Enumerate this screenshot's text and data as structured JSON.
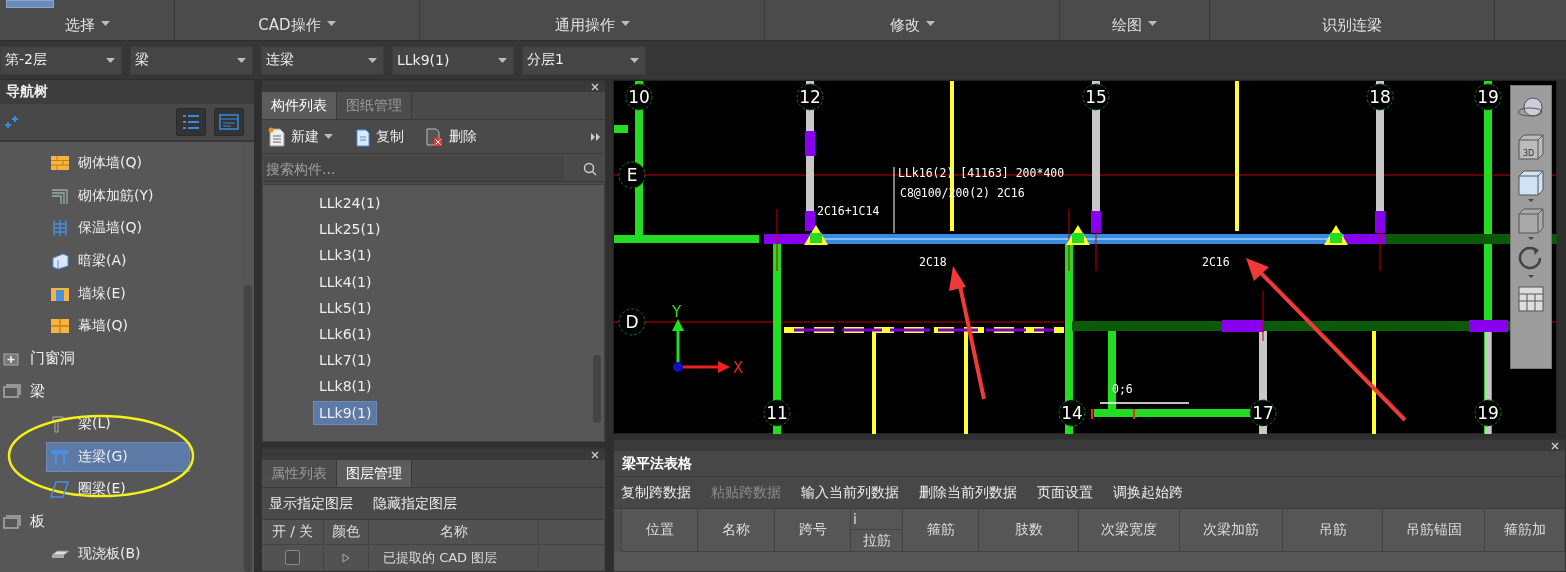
{
  "ribbon": {
    "groups": [
      {
        "label": "选择",
        "caret": true
      },
      {
        "label": "CAD操作",
        "caret": true
      },
      {
        "label": "通用操作",
        "caret": true
      },
      {
        "label": "修改",
        "caret": true
      },
      {
        "label": "绘图",
        "caret": true
      },
      {
        "label": "识别连梁",
        "caret": false
      }
    ]
  },
  "selectors": [
    {
      "value": "第-2层"
    },
    {
      "value": "梁"
    },
    {
      "value": "连梁"
    },
    {
      "value": "LLk9(1)"
    },
    {
      "value": "分层1"
    }
  ],
  "nav_tree": {
    "title": "导航树",
    "items": [
      {
        "kind": "leaf",
        "label": "砌体墙(Q)",
        "selected": false,
        "circled": false
      },
      {
        "kind": "leaf",
        "label": "砌体加筋(Y)",
        "selected": false,
        "circled": false
      },
      {
        "kind": "leaf",
        "label": "保温墙(Q)",
        "selected": false,
        "circled": false
      },
      {
        "kind": "leaf",
        "label": "暗梁(A)",
        "selected": false,
        "circled": false
      },
      {
        "kind": "leaf",
        "label": "墙垛(E)",
        "selected": false,
        "circled": false
      },
      {
        "kind": "leaf",
        "label": "幕墙(Q)",
        "selected": false,
        "circled": false
      },
      {
        "kind": "group",
        "label": "门窗洞",
        "expanded": false
      },
      {
        "kind": "group",
        "label": "梁",
        "expanded": true,
        "children": [
          {
            "kind": "leaf",
            "label": "梁(L)",
            "selected": false,
            "circled": false
          },
          {
            "kind": "leaf",
            "label": "连梁(G)",
            "selected": true,
            "circled": true
          },
          {
            "kind": "leaf",
            "label": "圈梁(E)",
            "selected": false,
            "circled": false
          }
        ]
      },
      {
        "kind": "group",
        "label": "板",
        "expanded": true,
        "children": [
          {
            "kind": "leaf",
            "label": "现浇板(B)",
            "selected": false,
            "circled": false
          }
        ]
      }
    ]
  },
  "component_panel": {
    "tabs": [
      {
        "label": "构件列表",
        "selected": true
      },
      {
        "label": "图纸管理",
        "selected": false
      }
    ],
    "toolbar": [
      {
        "label": "新建",
        "caret": true
      },
      {
        "label": "复制",
        "caret": false
      },
      {
        "label": "删除",
        "caret": false
      }
    ],
    "search": {
      "placeholder": "搜索构件..."
    },
    "items": [
      {
        "label": "LLk24(1)",
        "selected": false
      },
      {
        "label": "LLk25(1)",
        "selected": false
      },
      {
        "label": "LLk3(1)",
        "selected": false
      },
      {
        "label": "LLk4(1)",
        "selected": false
      },
      {
        "label": "LLk5(1)",
        "selected": false
      },
      {
        "label": "LLk6(1)",
        "selected": false
      },
      {
        "label": "LLk7(1)",
        "selected": false
      },
      {
        "label": "LLk8(1)",
        "selected": false
      },
      {
        "label": "LLk9(1)",
        "selected": true
      }
    ]
  },
  "layer_panel": {
    "tabs": [
      {
        "label": "属性列表",
        "selected": false
      },
      {
        "label": "图层管理",
        "selected": true
      }
    ],
    "buttons": [
      "显示指定图层",
      "隐藏指定图层"
    ],
    "columns": [
      "开 / 关",
      "颜色",
      "名称"
    ],
    "rows": [
      {
        "name": "已提取的 CAD 图层",
        "checked": false
      }
    ]
  },
  "canvas": {
    "grid_labels": [
      "10",
      "12",
      "15",
      "18",
      "19",
      "11",
      "14",
      "17",
      "19",
      "E",
      "D"
    ],
    "texts": [
      "LLk16(2) [41163] 200*400",
      "C8@100/200(2) 2C16",
      "2C16+1C14",
      "2C18",
      "2C16",
      "0;6"
    ],
    "axis_labels": [
      "Y",
      "X"
    ],
    "view_cube_label": "3D"
  },
  "beam_table": {
    "title": "梁平法表格",
    "toolbar": [
      {
        "label": "复制跨数据",
        "disabled": false
      },
      {
        "label": "粘贴跨数据",
        "disabled": true
      },
      {
        "label": "输入当前列数据",
        "disabled": false
      },
      {
        "label": "删除当前列数据",
        "disabled": false
      },
      {
        "label": "页面设置",
        "disabled": false
      },
      {
        "label": "调换起始跨",
        "disabled": false
      }
    ],
    "columns": [
      {
        "label": "位置"
      },
      {
        "label": "名称"
      },
      {
        "label": "跨号"
      },
      {
        "label": "拉筋",
        "group": "i"
      },
      {
        "label": "箍筋"
      },
      {
        "label": "肢数"
      },
      {
        "label": "次梁宽度"
      },
      {
        "label": "次梁加筋"
      },
      {
        "label": "吊筋"
      },
      {
        "label": "吊筋锚固"
      },
      {
        "label": "箍筋加"
      }
    ]
  }
}
